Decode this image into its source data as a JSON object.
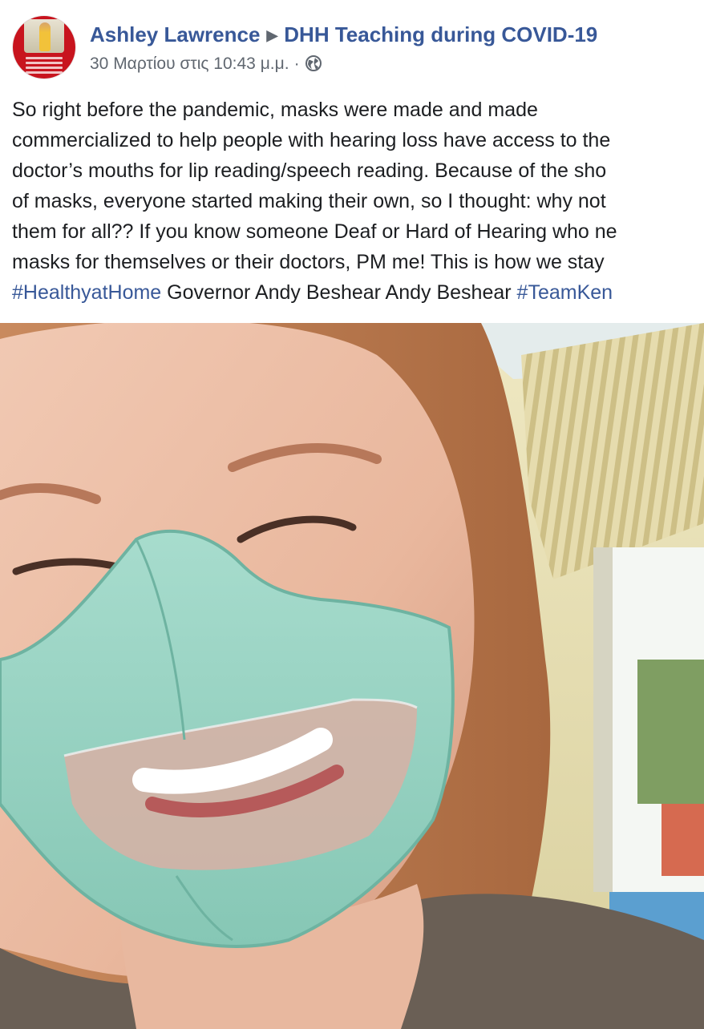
{
  "post": {
    "author": "Ashley Lawrence",
    "separator": "▶",
    "group": "DHH Teaching during COVID-19",
    "timestamp": "30 Μαρτίου στις 10:43 μ.μ.",
    "dot": "·",
    "audience_icon": "globe-icon",
    "text_lines": [
      "So right before the pandemic, masks were made and made",
      "commercialized to help people with hearing loss have access to the",
      "doctor’s mouths for lip reading/speech reading. Because of the sho",
      "of masks, everyone started making their own, so I thought: why not",
      "them for all?? If you know someone Deaf or Hard of Hearing who ne",
      "masks for themselves or their doctors, PM me! This is how we stay"
    ],
    "last_line": {
      "hashtag1": "#HealthyatHome",
      "mentions": " Governor Andy Beshear Andy Beshear ",
      "hashtag2": "#TeamKen"
    },
    "photo_icon": "selfie-photo"
  },
  "colors": {
    "link": "#385898",
    "text": "#1c1e21",
    "meta": "#606770"
  }
}
